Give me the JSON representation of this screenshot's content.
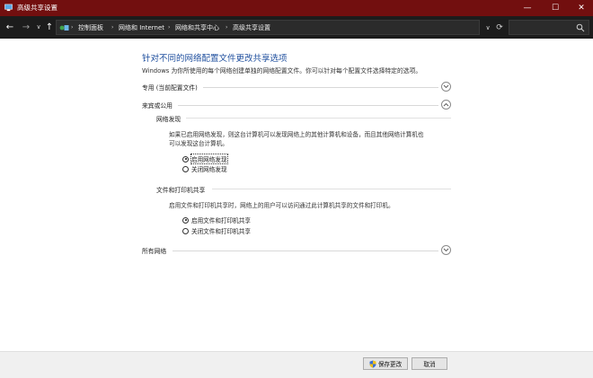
{
  "window": {
    "title": "高级共享设置",
    "minimize_glyph": "—",
    "maximize_glyph": "☐",
    "close_glyph": "✕"
  },
  "nav": {
    "back_glyph": "←",
    "forward_glyph": "→",
    "recent_glyph": "∨",
    "up_glyph": "↑"
  },
  "address": {
    "separator": "›",
    "crumbs": [
      "控制面板",
      "网络和 Internet",
      "网络和共享中心",
      "高级共享设置"
    ],
    "dropdown_glyph": "∨",
    "refresh_glyph": "⟳"
  },
  "main": {
    "heading": "针对不同的网络配置文件更改共享选项",
    "description": "Windows 为你所使用的每个网络创建单独的网络配置文件。你可以针对每个配置文件选择特定的选项。",
    "profiles": [
      {
        "label": "专用 (当前配置文件)",
        "expanded": false
      },
      {
        "label": "来宾或公用",
        "expanded": true
      },
      {
        "label": "所有网络",
        "expanded": false
      }
    ],
    "network_discovery": {
      "title": "网络发现",
      "desc_line1": "如果已启用网络发现，则这台计算机可以发现网络上的其他计算机和设备，而且其他网络计算机也",
      "desc_line2": "可以发现这台计算机。",
      "options": [
        "启用网络发现",
        "关闭网络发现"
      ],
      "selected_index": 0
    },
    "file_printer_sharing": {
      "title": "文件和打印机共享",
      "desc": "启用文件和打印机共享时，网络上的用户可以访问通过此计算机共享的文件和打印机。",
      "options": [
        "启用文件和打印机共享",
        "关闭文件和打印机共享"
      ],
      "selected_index": 0
    }
  },
  "footer": {
    "save_label": "保存更改",
    "cancel_label": "取消"
  },
  "colors": {
    "titlebar": "#720f0f",
    "navbar": "#1c1c1c",
    "heading": "#1f4f9e"
  }
}
